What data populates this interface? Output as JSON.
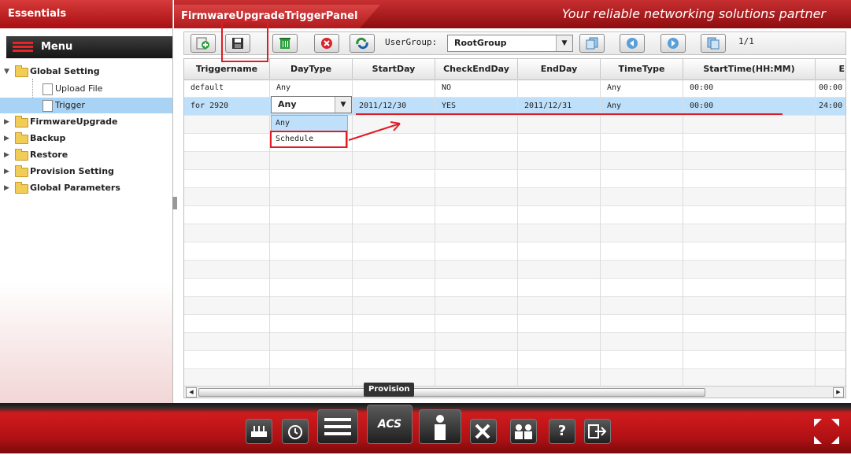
{
  "left_panel": {
    "title": "Essentials",
    "menu_label": "Menu",
    "tree": [
      {
        "label": "Global Setting",
        "expanded": true
      },
      {
        "label": "Upload File"
      },
      {
        "label": "Trigger",
        "selected": true
      },
      {
        "label": "FirmwareUpgrade"
      },
      {
        "label": "Backup"
      },
      {
        "label": "Restore"
      },
      {
        "label": "Provision Setting"
      },
      {
        "label": "Global Parameters"
      }
    ]
  },
  "header": {
    "panel_title": "FirmwareUpgradeTriggerPanel",
    "tagline": "Your reliable networking solutions partner"
  },
  "toolbar": {
    "add_icon": "add-icon",
    "save_icon": "save-icon",
    "delete_icon": "delete-icon",
    "cancel_icon": "cancel-icon",
    "refresh_icon": "refresh-icon",
    "usergroup_label": "UserGroup:",
    "usergroup_value": "RootGroup",
    "page_counter": "1/1"
  },
  "grid": {
    "columns": [
      "Triggername",
      "DayType",
      "StartDay",
      "CheckEndDay",
      "EndDay",
      "TimeType",
      "StartTime(HH:MM)",
      "E"
    ],
    "rows": [
      [
        "default",
        "Any",
        "",
        "NO",
        "",
        "Any",
        "00:00",
        "00:00"
      ],
      [
        "for 2920",
        "Any",
        "2011/12/30",
        "YES",
        "2011/12/31",
        "Any",
        "00:00",
        "24:00"
      ]
    ],
    "daytype_options": [
      "Any",
      "Schedule"
    ]
  },
  "tooltip": "Provision",
  "dock": {
    "items": [
      "router-icon",
      "alarm-icon",
      "list-icon",
      "acs-icon",
      "user-icon",
      "tools-icon",
      "group-icon",
      "help-icon",
      "logout-icon"
    ],
    "acs_label": "ACS",
    "help_label": "?"
  },
  "colors": {
    "brand_red": "#c72f31",
    "selection_blue": "#bfe0fb",
    "annotation_red": "#e01b24"
  }
}
